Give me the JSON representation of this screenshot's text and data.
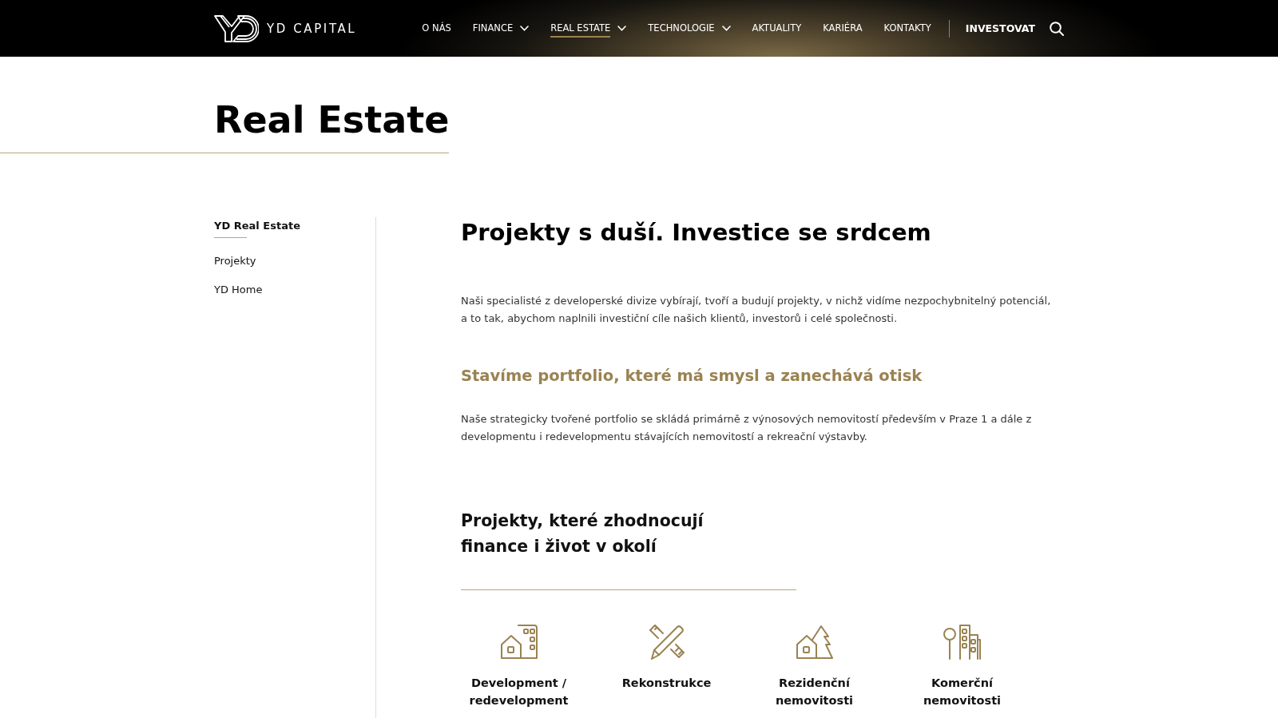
{
  "header": {
    "logo_text": "YD CAPITAL",
    "nav": [
      {
        "label": "O NÁS",
        "has_menu": false,
        "selected": false
      },
      {
        "label": "FINANCE",
        "has_menu": true,
        "selected": false
      },
      {
        "label": "REAL ESTATE",
        "has_menu": true,
        "selected": true
      },
      {
        "label": "TECHNOLOGIE",
        "has_menu": true,
        "selected": false
      },
      {
        "label": "AKTUALITY",
        "has_menu": false,
        "selected": false
      },
      {
        "label": "KARIÉRA",
        "has_menu": false,
        "selected": false
      },
      {
        "label": "KONTAKTY",
        "has_menu": false,
        "selected": false
      }
    ],
    "cta": "INVESTOVAT"
  },
  "page_title": "Real Estate",
  "sidebar": {
    "items": [
      {
        "label": "YD Real Estate",
        "selected": true
      },
      {
        "label": "Projekty",
        "selected": false
      },
      {
        "label": "YD Home",
        "selected": false
      }
    ]
  },
  "content": {
    "heading": "Projekty s duší. Investice se srdcem",
    "intro": "Naši specialisté z developerské divize vybírají, tvoří a budují projekty, v nichž vidíme nezpochybnitelný potenciál, a to tak, abychom naplnili investiční cíle našich klientů, investorů i celé společnosti.",
    "subheading": "Stavíme portfolio, které má smysl a zanechává otisk",
    "text": "Naše strategicky tvořené portfolio se skládá primárně z výnosových nemovitostí především v Praze 1 a dále z developmentu i redevelopmentu stávajících nemovitostí a rekreační výstavby.",
    "section_heading": [
      "Projekty, které zhodnocují",
      "finance i život v okolí"
    ],
    "categories": [
      {
        "kind": "house-building",
        "label": "Development / redevelopment"
      },
      {
        "kind": "pencil-ruler",
        "label": "Rekonstrukce"
      },
      {
        "kind": "house-tree",
        "label": "Rezidenční nemovitosti"
      },
      {
        "kind": "tree-building",
        "label": "Komerční nemovitosti"
      }
    ]
  }
}
